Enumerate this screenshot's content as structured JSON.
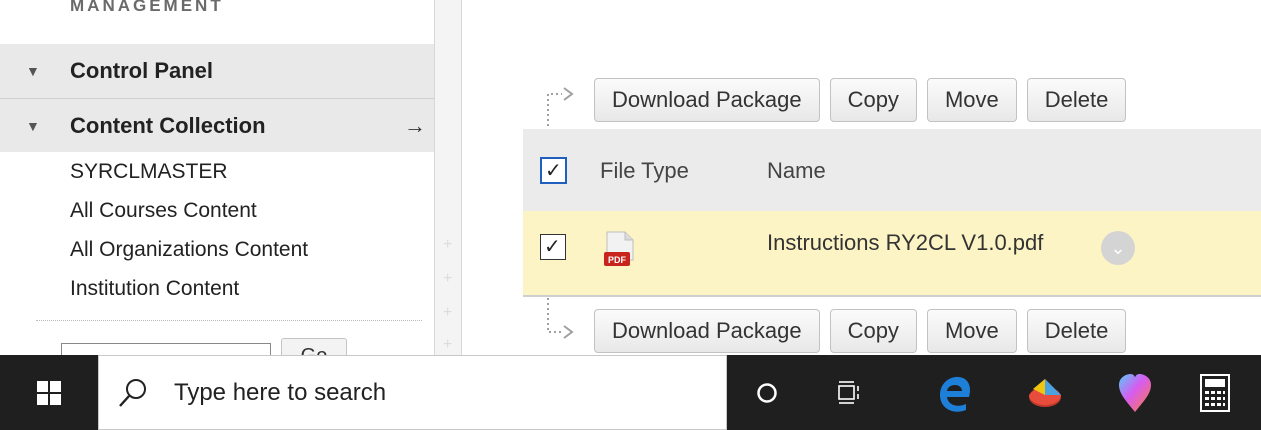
{
  "sidebar": {
    "section_label": "MANAGEMENT",
    "control_panel": "Control Panel",
    "content_collection": "Content Collection",
    "collection_arrow": "→",
    "links": [
      "SYRCLMASTER",
      "All Courses Content",
      "All Organizations Content",
      "Institution Content"
    ],
    "go_label": "Go"
  },
  "toolbar": {
    "download": "Download Package",
    "copy": "Copy",
    "move": "Move",
    "delete": "Delete"
  },
  "table": {
    "header_checked": true,
    "columns": [
      "File Type",
      "Name"
    ],
    "rows": [
      {
        "checked": true,
        "file_type_icon": "pdf-icon",
        "icon_text": "PDF",
        "name": "Instructions RY2CL V1.0.pdf"
      }
    ]
  },
  "taskbar": {
    "search_placeholder": "Type here to search",
    "icons": [
      "windows-start-icon",
      "cortana-icon",
      "task-view-icon",
      "edge-icon",
      "paint-3d-icon",
      "paint-icon",
      "calculator-icon"
    ]
  },
  "colors": {
    "selected_row": "#fdf4c6",
    "header_bg": "#ebebeb",
    "checkbox_focus": "#1f5fbf",
    "taskbar": "#1f1f1f",
    "edge_blue": "#1e7fd8"
  }
}
